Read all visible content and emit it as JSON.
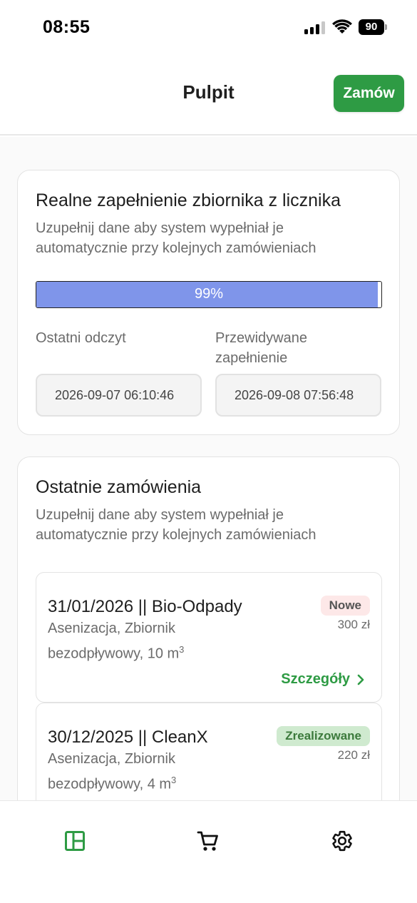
{
  "status_bar": {
    "time": "08:55",
    "battery": "90"
  },
  "header": {
    "title": "Pulpit",
    "order_button": "Zamów"
  },
  "tank_card": {
    "title": "Realne zapełnienie zbiornika z licznika",
    "subtitle": "Uzupełnij dane aby system wypełniał je automatycznie przy kolejnych zamówieniach",
    "progress_label": "99%",
    "progress_fraction": 0.99,
    "last_reading_label": "Ostatni odczyt",
    "last_reading_value": "2026-09-07 06:10:46",
    "predicted_label": "Przewidywane zapełnienie",
    "predicted_value": "2026-09-08 07:56:48"
  },
  "orders_card": {
    "title": "Ostatnie zamówienia",
    "subtitle": "Uzupełnij dane aby system wypełniał je automatycznie przy kolejnych zamówieniach",
    "details_label": "Szczegóły",
    "orders": [
      {
        "title": "31/01/2026 || Bio-Odpady",
        "desc": "Asenizacja, Zbiornik bezodpływowy, 10 m",
        "unit_sup": "3",
        "status": "Nowe",
        "price": "300 zł"
      },
      {
        "title": "30/12/2025 || CleanX",
        "desc": "Asenizacja, Zbiornik bezodpływowy, 4 m",
        "unit_sup": "3",
        "status": "Zrealizowane",
        "price": "220 zł"
      }
    ]
  },
  "colors": {
    "accent_green": "#2e9b44",
    "progress_fill": "#7f95ea",
    "badge_new_bg": "#fde8e8",
    "badge_done_bg": "#cfeacf"
  },
  "bottom_nav": {
    "items": [
      "dashboard-icon",
      "cart-icon",
      "settings-gear-icon"
    ],
    "active": "dashboard-icon"
  }
}
